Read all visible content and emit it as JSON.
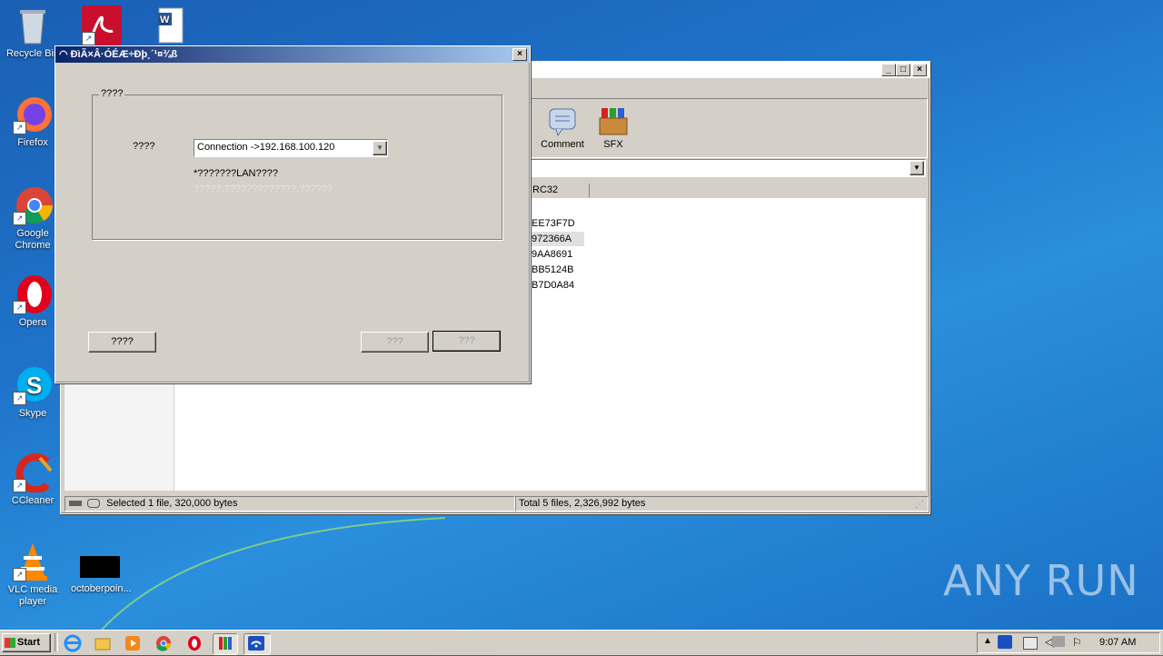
{
  "desktop": {
    "icons": [
      {
        "label": "Recycle Bin"
      },
      {
        "label": "Firefox"
      },
      {
        "label": "Google Chrome"
      },
      {
        "label": "Opera"
      },
      {
        "label": "Skype"
      },
      {
        "label": "CCleaner"
      },
      {
        "label": "VLC media player"
      },
      {
        "label": "octoberpoin..."
      }
    ],
    "watermark": "ANY RUN"
  },
  "back_window": {
    "toolbar": {
      "comment_label": "Comment",
      "sfx_label": "SFX"
    },
    "column_header": "RC32",
    "crc_values": [
      "EE73F7D",
      "972366A",
      "9AA8691",
      "BB5124B",
      "B7D0A84"
    ],
    "status_left": "Selected 1 file, 320,000 bytes",
    "status_right": "Total 5 files, 2,326,992 bytes"
  },
  "dialog": {
    "title": "ÐìÃ×Â·ÓÉÆ÷Ðþ¸´¹¤¾ß",
    "group_label": "????",
    "field_label": "????",
    "select_value": "Connection ->192.168.100.120",
    "note": "*???????LAN????",
    "disabled_note": "?????,?????????????,??????",
    "left_button": "????",
    "mid_button": "???",
    "right_button": "???"
  },
  "taskbar": {
    "start_label": "Start",
    "clock": "9:07 AM"
  }
}
